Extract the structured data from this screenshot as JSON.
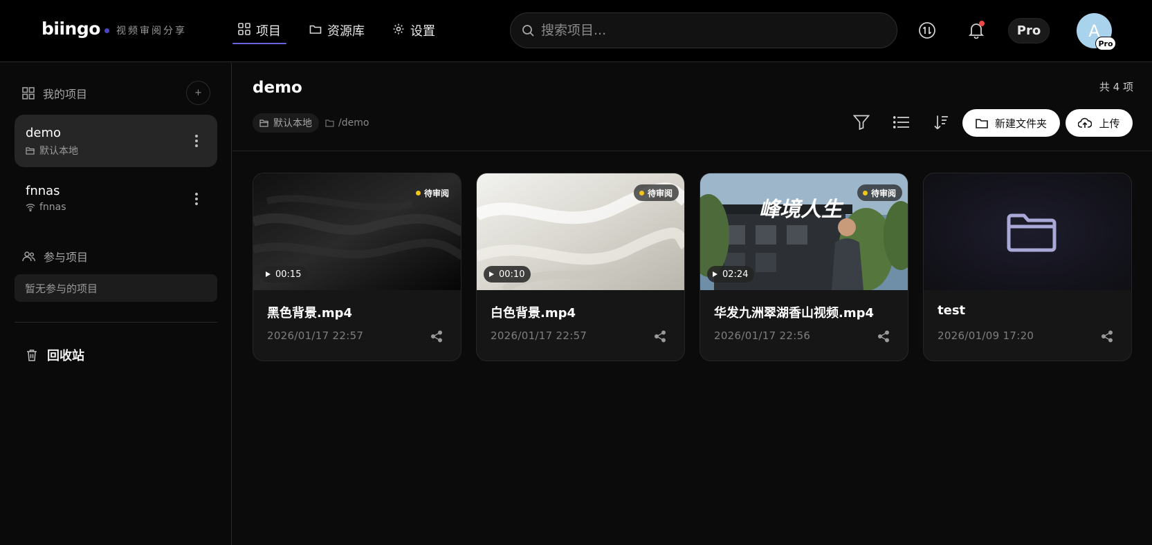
{
  "app": {
    "logo": "biingo",
    "tagline": "视频审阅分享",
    "accent": "#6a63e0"
  },
  "nav": {
    "items": [
      {
        "label": "项目",
        "icon": "grid-icon",
        "active": true
      },
      {
        "label": "资源库",
        "icon": "folder-icon",
        "active": false
      },
      {
        "label": "设置",
        "icon": "gear-icon",
        "active": false
      }
    ]
  },
  "search": {
    "placeholder": "搜索项目..."
  },
  "header": {
    "pro_label": "Pro",
    "avatar_initial": "A",
    "avatar_badge": "Pro",
    "notification_dot": true
  },
  "sidebar": {
    "my_projects_title": "我的项目",
    "add_label": "+",
    "projects": [
      {
        "name": "demo",
        "sub": "默认本地",
        "sub_icon": "folder-open-icon",
        "active": true
      },
      {
        "name": "fnnas",
        "sub": "fnnas",
        "sub_icon": "wifi-icon",
        "active": false
      }
    ],
    "joined_title": "参与项目",
    "joined_empty": "暂无参与的项目",
    "trash_label": "回收站"
  },
  "main": {
    "title": "demo",
    "count_label": "共 4 项",
    "storage_chip": "默认本地",
    "path": "/demo",
    "new_folder_label": "新建文件夹",
    "upload_label": "上传"
  },
  "cards": [
    {
      "name": "黑色背景.mp4",
      "date": "2026/01/17 22:57",
      "status": "待审阅",
      "duration": "00:15",
      "kind": "video-dark"
    },
    {
      "name": "白色背景.mp4",
      "date": "2026/01/17 22:57",
      "status": "待审阅",
      "duration": "00:10",
      "kind": "video-light"
    },
    {
      "name": "华发九洲翠湖香山视频.mp4",
      "date": "2026/01/17 22:56",
      "status": "待审阅",
      "duration": "02:24",
      "kind": "video-scene",
      "overlay_title": "峰境人生"
    },
    {
      "name": "test",
      "date": "2026/01/09 17:20",
      "kind": "folder"
    }
  ]
}
